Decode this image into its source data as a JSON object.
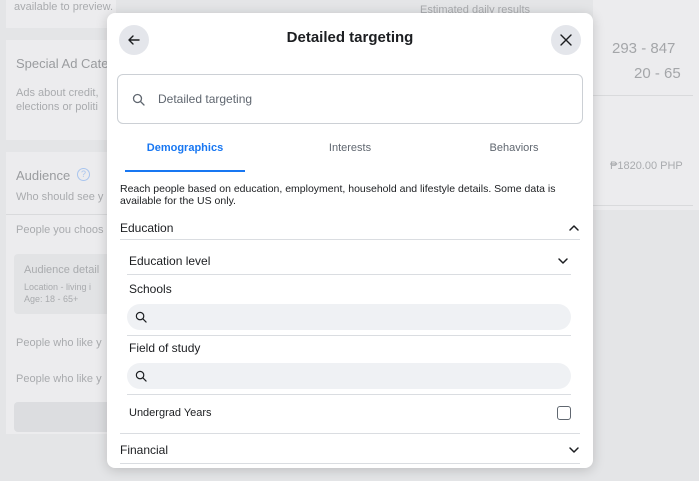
{
  "background": {
    "top_text": "available to preview.",
    "right_top_text": "Estimated daily results",
    "special_ad_title": "Special Ad Cate",
    "special_ad_desc_1": "Ads about credit,",
    "special_ad_desc_2": "elections or politi",
    "audience_title": "Audience",
    "audience_sub": "Who should see y",
    "people_choose": "People you choos",
    "audience_details": "Audience detail",
    "location": "Location - living i",
    "age": "Age: 18 - 65+",
    "people_like_1": "People who like y",
    "people_like_2": "People who like y",
    "range_1": "293 - 847",
    "range_2": "20 - 65",
    "budget": "₱1820.00 PHP"
  },
  "modal": {
    "title": "Detailed targeting",
    "search_placeholder": "Detailed targeting",
    "tabs": [
      {
        "label": "Demographics",
        "active": true
      },
      {
        "label": "Interests",
        "active": false
      },
      {
        "label": "Behaviors",
        "active": false
      }
    ],
    "description": "Reach people based on education, employment, household and lifestyle details. Some data is available for the US only.",
    "sections": {
      "education": "Education",
      "education_level": "Education level",
      "schools": "Schools",
      "field_of_study": "Field of study",
      "undergrad_years": "Undergrad Years",
      "financial": "Financial"
    }
  },
  "colors": {
    "accent": "#1877f2",
    "text": "#1c1e21",
    "muted": "#606770"
  }
}
